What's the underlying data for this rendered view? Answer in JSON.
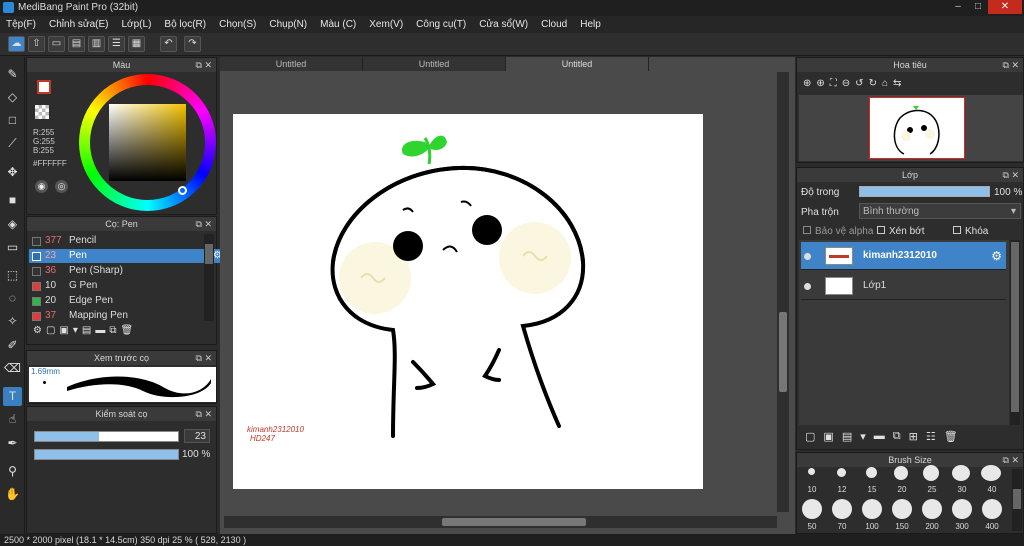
{
  "window": {
    "title": "MediBang Paint Pro (32bit)",
    "controls": [
      "–",
      "□",
      "✕"
    ]
  },
  "menu": [
    "Tệp(F)",
    "Chỉnh sửa(E)",
    "Lớp(L)",
    "Bộ lọc(R)",
    "Chọn(S)",
    "Chụp(N)",
    "Màu (C)",
    "Xem(V)",
    "Công cụ(T)",
    "Cửa sổ(W)",
    "Cloud",
    "Help"
  ],
  "color_panel": {
    "title": "Màu",
    "r": "R:255",
    "g": "G:255",
    "b": "B:255",
    "hex": "#FFFFFF",
    "primary_color": "#ffffff",
    "secondary_color": "#c0392b"
  },
  "brush_panel": {
    "title": "Cọ: Pen",
    "items": [
      {
        "size": "377",
        "name": "Pencil",
        "color": "#333333"
      },
      {
        "size": "23",
        "name": "Pen",
        "color": "#2a6fb8"
      },
      {
        "size": "36",
        "name": "Pen (Sharp)",
        "color": "#333333"
      },
      {
        "size": "10",
        "name": "G Pen",
        "color": "#e23b3b"
      },
      {
        "size": "20",
        "name": "Edge Pen",
        "color": "#2fb34a"
      },
      {
        "size": "37",
        "name": "Mapping Pen",
        "color": "#e23b3b"
      }
    ]
  },
  "preview_panel": {
    "title": "Xem trước cọ",
    "size": "1.69mm"
  },
  "control_panel": {
    "title": "Kiểm soát cọ",
    "size_value": "23",
    "opacity_value": "100 %",
    "size_fill": 0.45,
    "opacity_fill": 1.0
  },
  "tabs": [
    "Untitled",
    "Untitled",
    "Untitled"
  ],
  "canvas": {
    "signature_line1": "kimanh2312010",
    "signature_line2": "HD247"
  },
  "navigator_panel": {
    "title": "Hoa tiêu"
  },
  "layer_panel": {
    "title": "Lớp",
    "opacity_label": "Độ trong",
    "opacity_value": "100 %",
    "blend_label": "Pha trộn",
    "blend_value": "Bình thường",
    "protect_alpha": "Bảo vệ alpha",
    "clipping": "Xén bớt",
    "lock": "Khóa",
    "layers": [
      {
        "name": "kimanh2312010",
        "selected": true
      },
      {
        "name": "Lớp1",
        "selected": false
      }
    ]
  },
  "brush_size_panel": {
    "title": "Brush Size",
    "row1": [
      "10",
      "12",
      "15",
      "20",
      "25",
      "30",
      "40"
    ],
    "row2": [
      "50",
      "70",
      "100",
      "150",
      "200",
      "300",
      "400"
    ]
  },
  "status": {
    "text": "2500 * 2000 pixel   (18.1 * 14.5cm)   350 dpi   25 %   ( 528, 2130 )"
  }
}
